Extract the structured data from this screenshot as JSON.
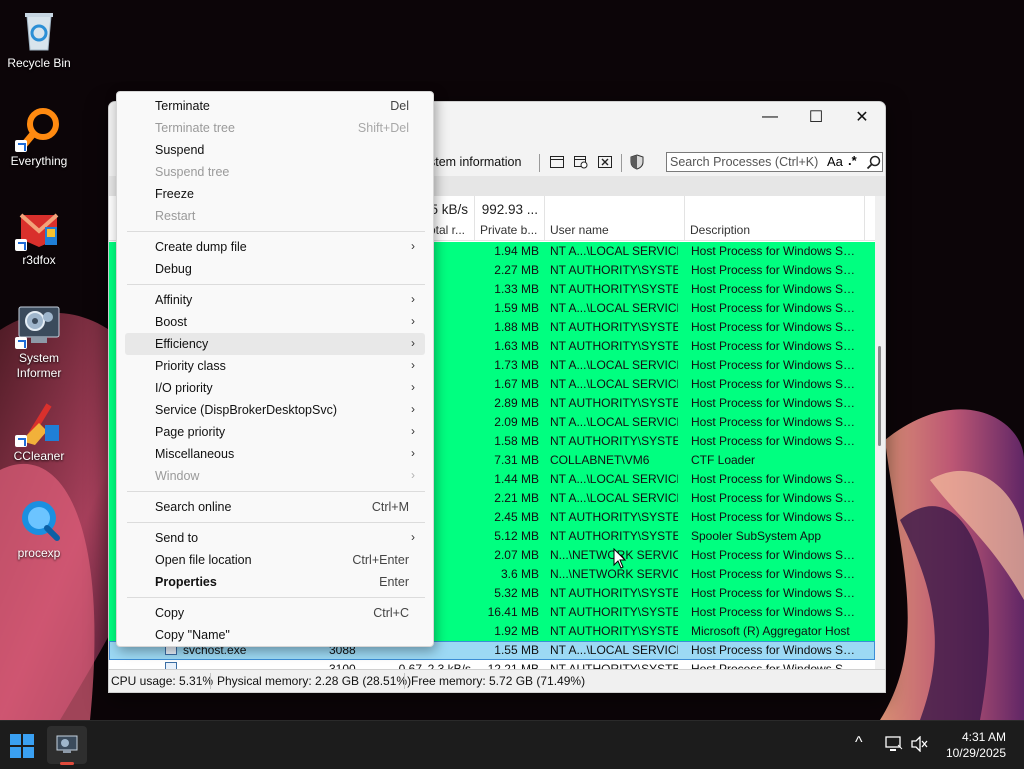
{
  "desktop": {
    "icons": [
      {
        "label": "Recycle Bin",
        "icon": "recycle-bin-icon"
      },
      {
        "label": "Everything",
        "icon": "magnifier-icon"
      },
      {
        "label": "r3dfox",
        "icon": "browser-icon"
      },
      {
        "label": "System Informer",
        "icon": "system-informer-icon"
      },
      {
        "label": "CCleaner",
        "icon": "ccleaner-icon"
      },
      {
        "label": "procexp",
        "icon": "procexp-icon"
      }
    ]
  },
  "window": {
    "controls": {
      "minimize": "—",
      "maximize": "☐",
      "close": "✕"
    },
    "toolbar": {
      "system_information": "stem information"
    },
    "search": {
      "placeholder": "Search Processes (Ctrl+K)",
      "case_label": "Aa",
      "regex_label": ".*"
    },
    "columns": {
      "total_rate": {
        "agg": "5 kB/s",
        "name": "otal r..."
      },
      "private_bytes": {
        "agg": "992.93 ...",
        "name": "Private b..."
      },
      "user_name": {
        "name": "User name"
      },
      "description": {
        "name": "Description"
      }
    },
    "rows": [
      {
        "private": "1.94 MB",
        "user": "NT A...\\LOCAL SERVICE",
        "desc": "Host Process for Windows Ser..."
      },
      {
        "private": "2.27 MB",
        "user": "NT AUTHORITY\\SYSTEM",
        "desc": "Host Process for Windows Ser..."
      },
      {
        "private": "1.33 MB",
        "user": "NT AUTHORITY\\SYSTEM",
        "desc": "Host Process for Windows Ser..."
      },
      {
        "private": "1.59 MB",
        "user": "NT A...\\LOCAL SERVICE",
        "desc": "Host Process for Windows Ser..."
      },
      {
        "private": "1.88 MB",
        "user": "NT AUTHORITY\\SYSTEM",
        "desc": "Host Process for Windows Ser..."
      },
      {
        "private": "1.63 MB",
        "user": "NT AUTHORITY\\SYSTEM",
        "desc": "Host Process for Windows Ser..."
      },
      {
        "private": "1.73 MB",
        "user": "NT A...\\LOCAL SERVICE",
        "desc": "Host Process for Windows Ser..."
      },
      {
        "private": "1.67 MB",
        "user": "NT A...\\LOCAL SERVICE",
        "desc": "Host Process for Windows Ser..."
      },
      {
        "private": "2.89 MB",
        "user": "NT AUTHORITY\\SYSTEM",
        "desc": "Host Process for Windows Ser..."
      },
      {
        "private": "2.09 MB",
        "user": "NT A...\\LOCAL SERVICE",
        "desc": "Host Process for Windows Ser..."
      },
      {
        "private": "1.58 MB",
        "user": "NT AUTHORITY\\SYSTEM",
        "desc": "Host Process for Windows Ser..."
      },
      {
        "private": "7.31 MB",
        "user": "COLLABNET\\VM6",
        "desc": "CTF Loader"
      },
      {
        "private": "1.44 MB",
        "user": "NT A...\\LOCAL SERVICE",
        "desc": "Host Process for Windows Ser..."
      },
      {
        "private": "2.21 MB",
        "user": "NT A...\\LOCAL SERVICE",
        "desc": "Host Process for Windows Ser..."
      },
      {
        "private": "2.45 MB",
        "user": "NT AUTHORITY\\SYSTEM",
        "desc": "Host Process for Windows Ser..."
      },
      {
        "private": "5.12 MB",
        "user": "NT AUTHORITY\\SYSTEM",
        "desc": "Spooler SubSystem App"
      },
      {
        "private": "2.07 MB",
        "user": "N...\\NETWORK SERVICE",
        "desc": "Host Process for Windows Ser..."
      },
      {
        "private": "3.6 MB",
        "user": "N...\\NETWORK SERVICE",
        "desc": "Host Process for Windows Ser..."
      },
      {
        "private": "5.32 MB",
        "user": "NT AUTHORITY\\SYSTEM",
        "desc": "Host Process for Windows Ser..."
      },
      {
        "private": "16.41 MB",
        "user": "NT AUTHORITY\\SYSTEM",
        "desc": "Host Process for Windows Ser..."
      },
      {
        "private": "1.92 MB",
        "user": "NT AUTHORITY\\SYSTEM",
        "desc": "Microsoft (R) Aggregator Host"
      },
      {
        "name": "svchost.exe",
        "pid": "3088",
        "private": "1.55 MB",
        "user": "NT A...\\LOCAL SERVICE",
        "desc": "Host Process for Windows Ser...",
        "selected": true
      },
      {
        "name": "...",
        "pid": "3100",
        "cpu": "0.67",
        "io": "2.3 kB/s",
        "private": "12.21 MB",
        "user": "NT AUTHORITY\\SYSTEM",
        "desc": "Host Process for Windows Ser...",
        "partial": true
      }
    ],
    "status": {
      "cpu": "CPU usage: 5.31%",
      "physical": "Physical memory: 2.28 GB (28.51%)",
      "free": "Free memory: 5.72 GB (71.49%)"
    }
  },
  "context_menu": {
    "items": [
      {
        "label": "Terminate",
        "shortcut": "Del"
      },
      {
        "label": "Terminate tree",
        "shortcut": "Shift+Del",
        "disabled": true
      },
      {
        "label": "Suspend"
      },
      {
        "label": "Suspend tree",
        "disabled": true
      },
      {
        "label": "Freeze"
      },
      {
        "label": "Restart",
        "disabled": true
      },
      {
        "separator": true
      },
      {
        "label": "Create dump file",
        "submenu": true
      },
      {
        "label": "Debug"
      },
      {
        "separator": true
      },
      {
        "label": "Affinity",
        "submenu": true
      },
      {
        "label": "Boost",
        "submenu": true
      },
      {
        "label": "Efficiency",
        "submenu": true,
        "hover": true
      },
      {
        "label": "Priority class",
        "submenu": true
      },
      {
        "label": "I/O priority",
        "submenu": true
      },
      {
        "label": "Service (DispBrokerDesktopSvc)",
        "submenu": true
      },
      {
        "label": "Page priority",
        "submenu": true
      },
      {
        "label": "Miscellaneous",
        "submenu": true
      },
      {
        "label": "Window",
        "submenu": true,
        "disabled": true
      },
      {
        "separator": true
      },
      {
        "label": "Search online",
        "shortcut": "Ctrl+M"
      },
      {
        "separator": true
      },
      {
        "label": "Send to",
        "submenu": true
      },
      {
        "label": "Open file location",
        "shortcut": "Ctrl+Enter"
      },
      {
        "label": "Properties",
        "shortcut": "Enter",
        "bold": true
      },
      {
        "separator": true
      },
      {
        "label": "Copy",
        "shortcut": "Ctrl+C"
      },
      {
        "label": "Copy \"Name\""
      }
    ]
  },
  "taskbar": {
    "time": "4:31 AM",
    "date": "10/29/2025",
    "tray_chevron": "^"
  },
  "colors": {
    "row_highlight": "#00ff80",
    "row_selected": "#9cd9f4",
    "taskbar": "#1c1c1c",
    "accent": "#0078d4"
  }
}
